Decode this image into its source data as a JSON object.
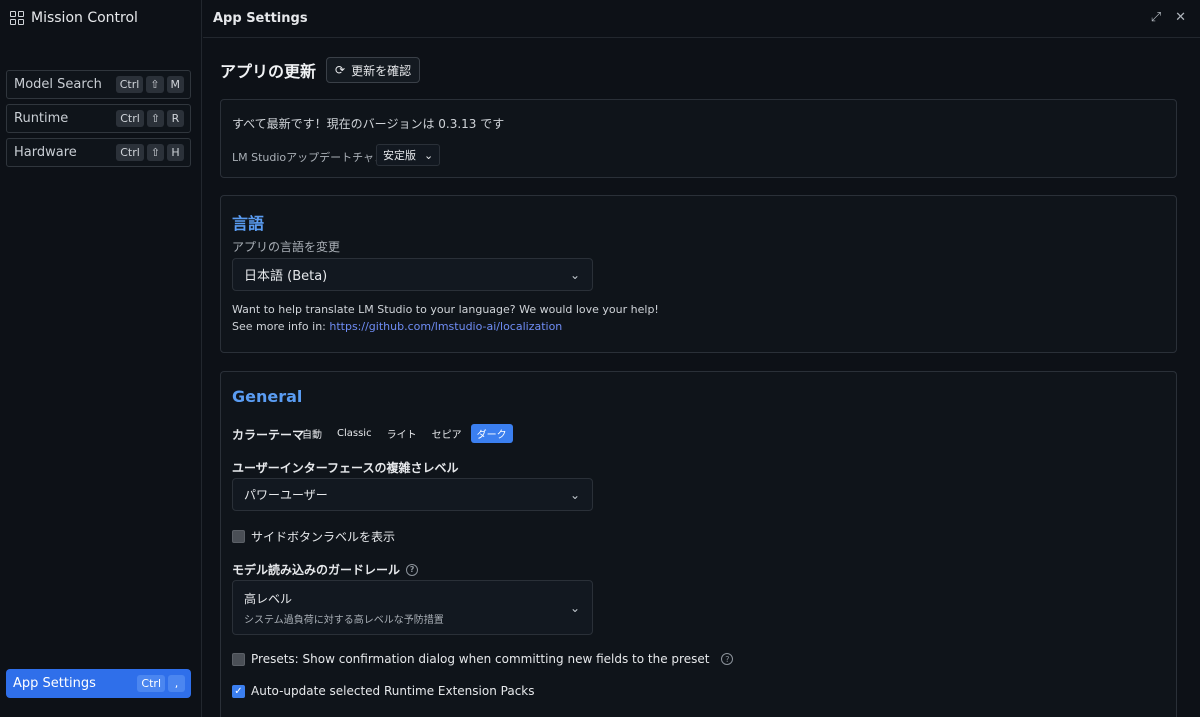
{
  "sidebar": {
    "title": "Mission Control",
    "items": [
      {
        "label": "Model Search",
        "keys": [
          "Ctrl",
          "⇧",
          "M"
        ]
      },
      {
        "label": "Runtime",
        "keys": [
          "Ctrl",
          "⇧",
          "R"
        ]
      },
      {
        "label": "Hardware",
        "keys": [
          "Ctrl",
          "⇧",
          "H"
        ]
      }
    ],
    "active": {
      "label": "App Settings",
      "keys": [
        "Ctrl",
        ","
      ]
    }
  },
  "header": {
    "title": "App Settings"
  },
  "update": {
    "heading": "アプリの更新",
    "check_button": "更新を確認",
    "status": "すべて最新です！現在のバージョンは 0.3.13 です",
    "channel_label": "LM Studioアップデートチャンネル",
    "channel_value": "安定版"
  },
  "language": {
    "title": "言語",
    "label": "アプリの言語を変更",
    "value": "日本語 (Beta)",
    "help_line1": "Want to help translate LM Studio to your language? We would love your help!",
    "help_line2_prefix": "See more info in: ",
    "help_link": "https://github.com/lmstudio-ai/localization"
  },
  "general": {
    "title": "General",
    "theme_label": "カラーテーマ",
    "themes": [
      "自動",
      "Classic",
      "ライト",
      "セピア",
      "ダーク"
    ],
    "selected_theme": "ダーク",
    "ui_level_label": "ユーザーインターフェースの複雑さレベル",
    "ui_level_value": "パワーユーザー",
    "side_labels_checkbox": "サイドボタンラベルを表示",
    "side_labels_checked": false,
    "guardrail_label": "モデル読み込みのガードレール",
    "guardrail_value": "高レベル",
    "guardrail_desc": "システム過負荷に対する高レベルな予防措置",
    "presets_checkbox": "Presets: Show confirmation dialog when committing new fields to the preset",
    "presets_checked": false,
    "auto_update_checkbox": "Auto-update selected Runtime Extension Packs",
    "auto_update_checked": true
  },
  "colors": {
    "accent": "#3b7ff0",
    "heading_blue": "#5a9cf2",
    "link": "#6f8df5",
    "background": "#0d1117"
  }
}
